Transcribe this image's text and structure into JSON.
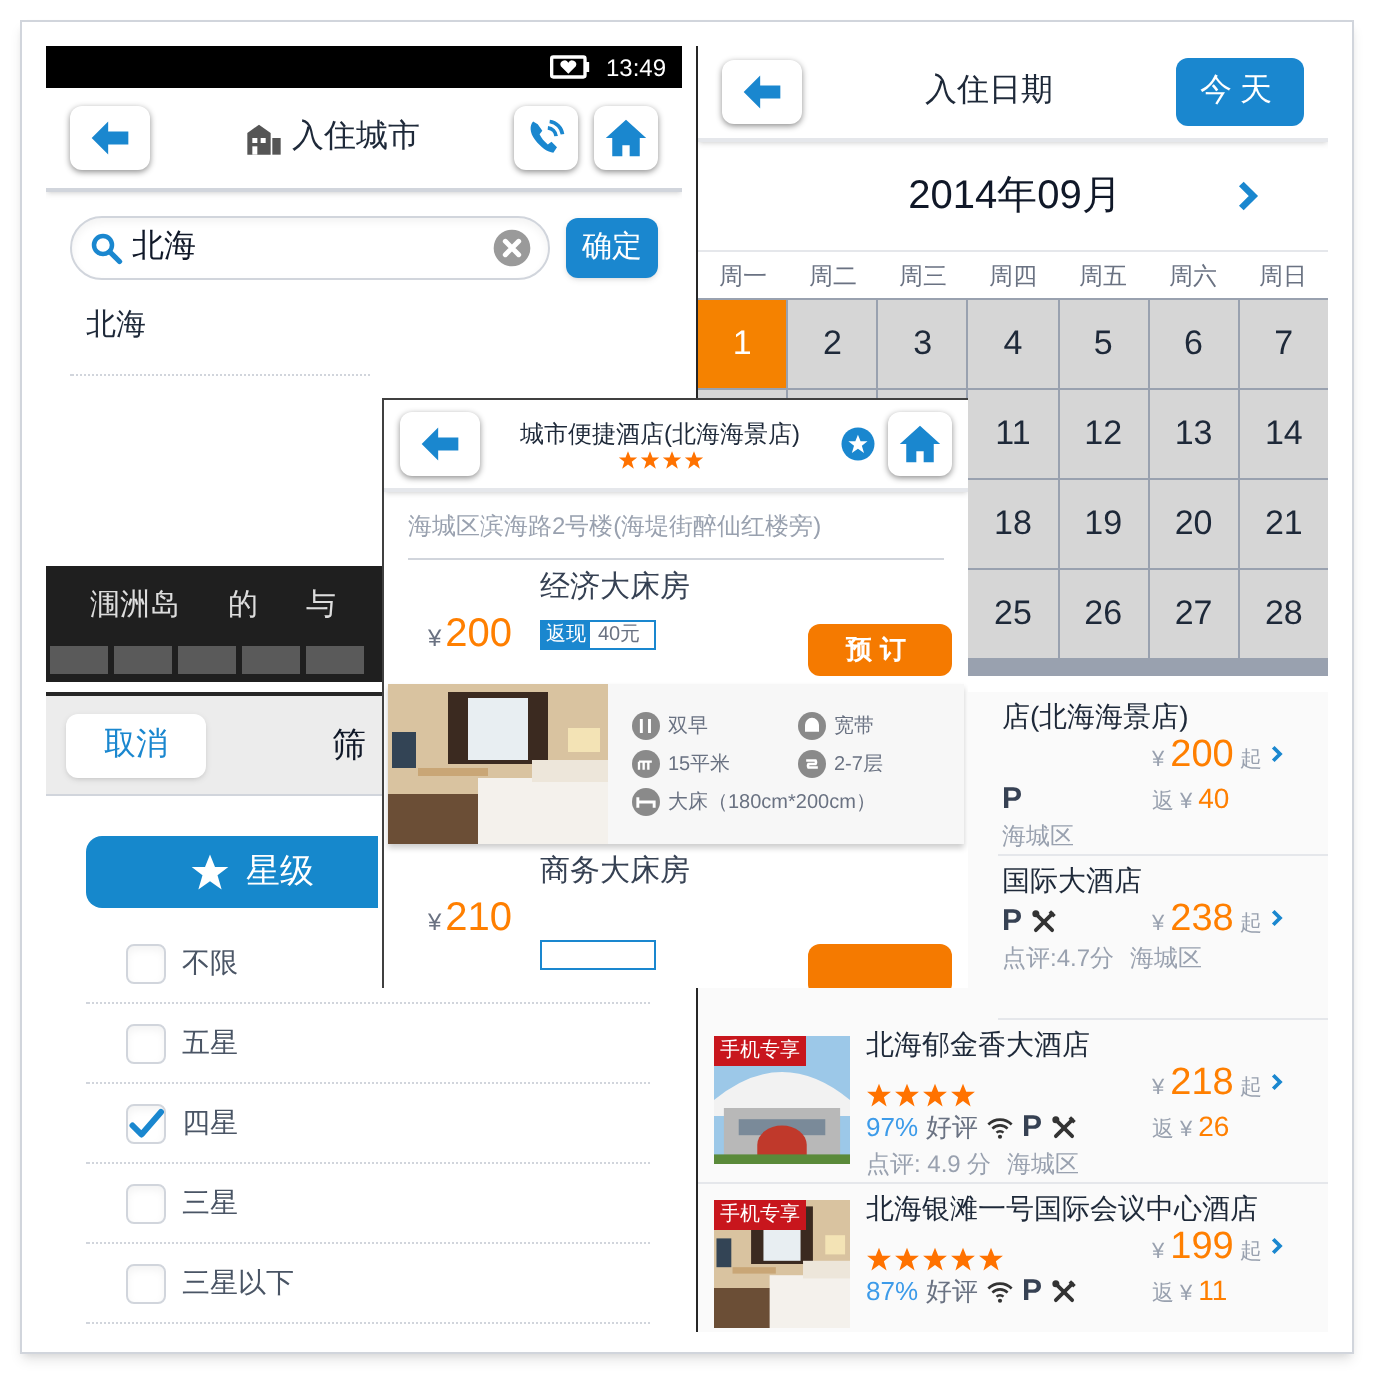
{
  "city_screen": {
    "status_bar": {
      "time": "13:49"
    },
    "title": "入住城市",
    "search": {
      "value": "北海"
    },
    "confirm_button": "确定",
    "results": [
      "北海"
    ],
    "suggestions": [
      "涠洲岛",
      "的",
      "与"
    ]
  },
  "date_screen": {
    "title": "入住日期",
    "today_button": "今天",
    "month": "2014年09月",
    "weekdays": [
      "周一",
      "周二",
      "周三",
      "周四",
      "周五",
      "周六",
      "周日"
    ],
    "weeks": [
      [
        {
          "day": "1",
          "selected": true
        },
        {
          "day": "2",
          "selected": false
        },
        {
          "day": "3",
          "selected": false
        },
        {
          "day": "4",
          "selected": false
        },
        {
          "day": "5",
          "selected": false
        },
        {
          "day": "6",
          "selected": false
        },
        {
          "day": "7",
          "selected": false
        }
      ],
      [
        {
          "day": "11",
          "selected": false
        },
        {
          "day": "12",
          "selected": false
        },
        {
          "day": "13",
          "selected": false
        },
        {
          "day": "14",
          "selected": false
        }
      ],
      [
        {
          "day": "18",
          "selected": false
        },
        {
          "day": "19",
          "selected": false
        },
        {
          "day": "20",
          "selected": false
        },
        {
          "day": "21",
          "selected": false
        }
      ],
      [
        {
          "day": "25",
          "selected": false
        },
        {
          "day": "26",
          "selected": false
        },
        {
          "day": "27",
          "selected": false
        },
        {
          "day": "28",
          "selected": false
        }
      ]
    ]
  },
  "filter_screen": {
    "cancel_button": "取消",
    "title": "筛",
    "tab": "星级",
    "options": [
      {
        "label": "不限",
        "checked": false
      },
      {
        "label": "五星",
        "checked": false
      },
      {
        "label": "四星",
        "checked": true
      },
      {
        "label": "三星",
        "checked": false
      },
      {
        "label": "三星以下",
        "checked": false
      }
    ]
  },
  "hotel_list": {
    "hotels": [
      {
        "kind": "cut",
        "name": "店(北海海景店)",
        "currency": "¥",
        "price": "200",
        "from": "起",
        "cashback_label": "返",
        "cashback_currency": "¥",
        "cashback": "40",
        "wifi": false,
        "parking": "P",
        "restaurant": false,
        "district": "海城区"
      },
      {
        "kind": "cut",
        "name": "国际大酒店",
        "currency": "¥",
        "price": "238",
        "from": "起",
        "wifi": false,
        "parking": "P",
        "restaurant": true,
        "review": "点评:4.7分",
        "district": "海城区"
      },
      {
        "kind": "full",
        "badge": "手机专享",
        "name": "北海郁金香大酒店",
        "stars": 4,
        "rating": "97%",
        "rating_label": "好评",
        "wifi": true,
        "parking": "P",
        "restaurant": true,
        "review": "点评: 4.9 分",
        "district": "海城区",
        "currency": "¥",
        "price": "218",
        "from": "起",
        "cashback_label": "返",
        "cashback_currency": "¥",
        "cashback": "26"
      },
      {
        "kind": "full",
        "badge": "手机专享",
        "name": "北海银滩一号国际会议中心酒店",
        "stars": 5,
        "rating": "87%",
        "rating_label": "好评",
        "wifi": true,
        "parking": "P",
        "restaurant": true,
        "currency": "¥",
        "price": "199",
        "from": "起",
        "cashback_label": "返",
        "cashback_currency": "¥",
        "cashback": "11"
      }
    ]
  },
  "hotel_detail": {
    "title": "城市便捷酒店(北海海景店)",
    "stars": 4,
    "address": "海城区滨海路2号楼(海堤街醉仙红楼旁)",
    "rooms": [
      {
        "kind": "full",
        "name": "经济大床房",
        "currency": "¥",
        "price": "200",
        "cashback_label": "返现",
        "cashback": "40元",
        "book_button": "预订"
      },
      {
        "kind": "cut",
        "name": "商务大床房",
        "currency": "¥",
        "price": "210"
      }
    ],
    "room_info": {
      "amenities": [
        {
          "kind": "breakfast",
          "label": "双早"
        },
        {
          "kind": "broadband",
          "label": "宽带"
        },
        {
          "kind": "area",
          "label": "15平米"
        },
        {
          "kind": "floor",
          "label": "2-7层"
        },
        {
          "kind": "bed",
          "label": "大床（180cm*200cm）"
        }
      ]
    }
  }
}
